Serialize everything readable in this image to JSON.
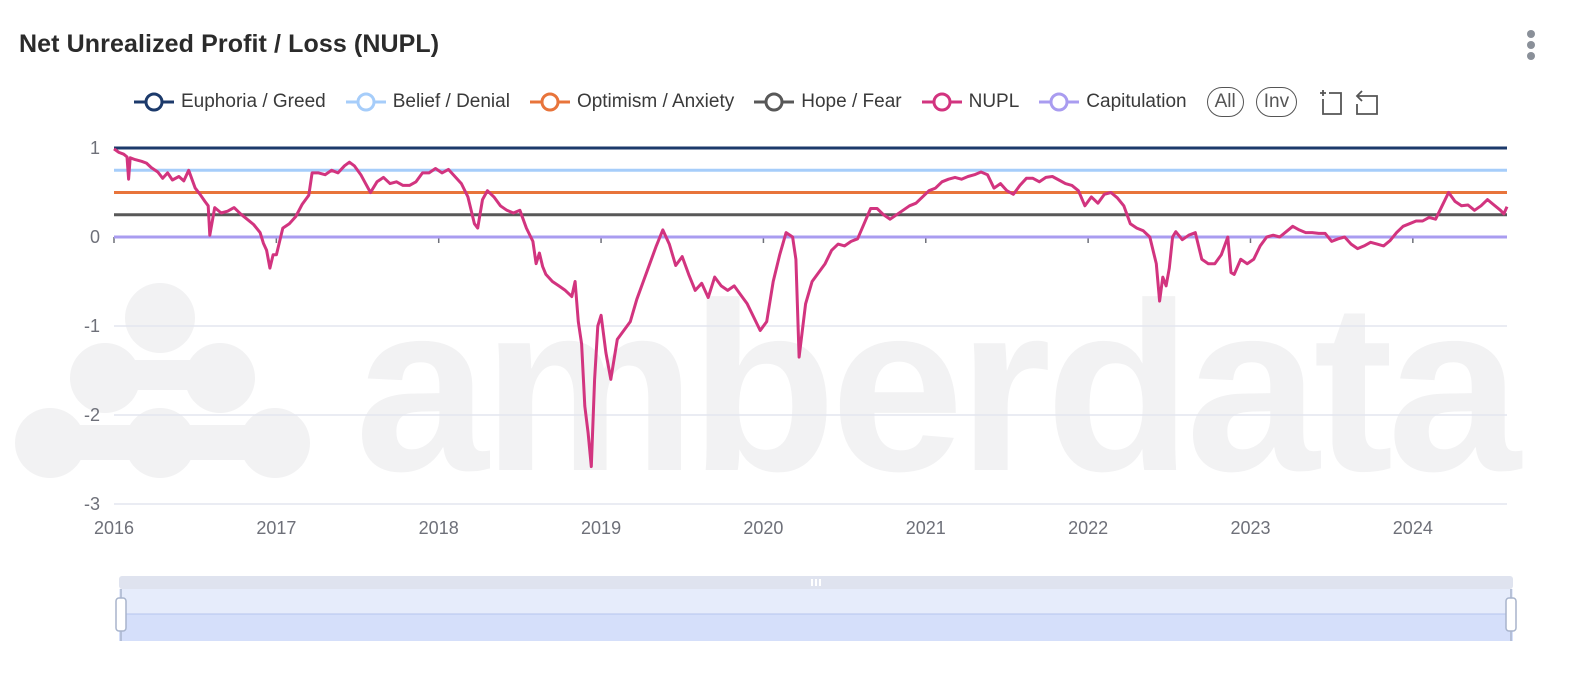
{
  "header": {
    "title": "Net Unrealized Profit / Loss (NUPL)",
    "menu_icon": "more-vertical-icon"
  },
  "legend": {
    "items": [
      {
        "label": "Euphoria / Greed",
        "color": "#1c3a6b"
      },
      {
        "label": "Belief / Denial",
        "color": "#a6cdfa"
      },
      {
        "label": "Optimism / Anxiety",
        "color": "#e8743b"
      },
      {
        "label": "Hope / Fear",
        "color": "#585858"
      },
      {
        "label": "NUPL",
        "color": "#d2347f"
      },
      {
        "label": "Capitulation",
        "color": "#a99cf0"
      }
    ],
    "all_label": "All",
    "inv_label": "Inv",
    "tools": [
      "zoom-select-icon",
      "zoom-reset-icon"
    ]
  },
  "watermark": "amberdata",
  "chart_data": {
    "type": "line",
    "title": "Net Unrealized Profit / Loss (NUPL)",
    "xlabel": "",
    "ylabel": "",
    "xlim": [
      2016.0,
      2024.58
    ],
    "ylim": [
      -3,
      1
    ],
    "x_ticks": [
      "2016",
      "2017",
      "2018",
      "2019",
      "2020",
      "2021",
      "2022",
      "2023",
      "2024"
    ],
    "y_ticks": [
      "1",
      "0",
      "-1",
      "-2",
      "-3"
    ],
    "grid": true,
    "legend_position": "top-right",
    "reference_lines": [
      {
        "name": "Euphoria / Greed",
        "value": 1.0,
        "color": "#1c3a6b"
      },
      {
        "name": "Belief / Denial",
        "value": 0.75,
        "color": "#a6cdfa"
      },
      {
        "name": "Optimism / Anxiety",
        "value": 0.5,
        "color": "#e8743b"
      },
      {
        "name": "Hope / Fear",
        "value": 0.25,
        "color": "#585858"
      },
      {
        "name": "Capitulation",
        "value": 0.0,
        "color": "#a99cf0"
      }
    ],
    "series": [
      {
        "name": "NUPL",
        "color": "#d2347f",
        "x": [
          2016.0,
          2016.03,
          2016.06,
          2016.08,
          2016.09,
          2016.1,
          2016.13,
          2016.17,
          2016.2,
          2016.23,
          2016.27,
          2016.3,
          2016.33,
          2016.36,
          2016.4,
          2016.43,
          2016.46,
          2016.5,
          2016.53,
          2016.56,
          2016.58,
          2016.59,
          2016.62,
          2016.66,
          2016.7,
          2016.74,
          2016.78,
          2016.82,
          2016.86,
          2016.9,
          2016.92,
          2016.94,
          2016.96,
          2016.98,
          2017.0,
          2017.04,
          2017.08,
          2017.12,
          2017.16,
          2017.2,
          2017.22,
          2017.26,
          2017.3,
          2017.34,
          2017.38,
          2017.42,
          2017.45,
          2017.48,
          2017.52,
          2017.55,
          2017.58,
          2017.62,
          2017.66,
          2017.7,
          2017.74,
          2017.78,
          2017.82,
          2017.86,
          2017.9,
          2017.94,
          2017.98,
          2018.02,
          2018.06,
          2018.1,
          2018.14,
          2018.18,
          2018.22,
          2018.24,
          2018.27,
          2018.3,
          2018.34,
          2018.38,
          2018.42,
          2018.46,
          2018.5,
          2018.54,
          2018.58,
          2018.6,
          2018.62,
          2018.64,
          2018.66,
          2018.7,
          2018.74,
          2018.78,
          2018.82,
          2018.84,
          2018.86,
          2018.88,
          2018.9,
          2018.92,
          2018.94,
          2018.96,
          2018.98,
          2019.0,
          2019.03,
          2019.06,
          2019.1,
          2019.14,
          2019.18,
          2019.22,
          2019.26,
          2019.3,
          2019.34,
          2019.38,
          2019.42,
          2019.46,
          2019.5,
          2019.54,
          2019.58,
          2019.62,
          2019.66,
          2019.7,
          2019.74,
          2019.78,
          2019.82,
          2019.86,
          2019.9,
          2019.94,
          2019.98,
          2020.02,
          2020.06,
          2020.1,
          2020.14,
          2020.18,
          2020.2,
          2020.22,
          2020.26,
          2020.3,
          2020.34,
          2020.38,
          2020.42,
          2020.46,
          2020.5,
          2020.54,
          2020.58,
          2020.62,
          2020.66,
          2020.7,
          2020.74,
          2020.78,
          2020.82,
          2020.86,
          2020.9,
          2020.94,
          2020.98,
          2021.02,
          2021.06,
          2021.1,
          2021.14,
          2021.18,
          2021.22,
          2021.26,
          2021.3,
          2021.34,
          2021.38,
          2021.42,
          2021.46,
          2021.5,
          2021.54,
          2021.58,
          2021.62,
          2021.66,
          2021.7,
          2021.74,
          2021.78,
          2021.82,
          2021.86,
          2021.9,
          2021.94,
          2021.98,
          2022.02,
          2022.06,
          2022.1,
          2022.14,
          2022.18,
          2022.22,
          2022.26,
          2022.3,
          2022.34,
          2022.38,
          2022.42,
          2022.44,
          2022.46,
          2022.48,
          2022.5,
          2022.52,
          2022.54,
          2022.58,
          2022.62,
          2022.66,
          2022.7,
          2022.74,
          2022.78,
          2022.82,
          2022.86,
          2022.88,
          2022.9,
          2022.94,
          2022.98,
          2023.02,
          2023.06,
          2023.1,
          2023.14,
          2023.18,
          2023.22,
          2023.26,
          2023.3,
          2023.34,
          2023.38,
          2023.42,
          2023.46,
          2023.5,
          2023.54,
          2023.58,
          2023.62,
          2023.66,
          2023.7,
          2023.74,
          2023.78,
          2023.82,
          2023.86,
          2023.9,
          2023.94,
          2023.98,
          2024.02,
          2024.06,
          2024.1,
          2024.14,
          2024.18,
          2024.22,
          2024.26,
          2024.3,
          2024.34,
          2024.38,
          2024.42,
          2024.46,
          2024.5,
          2024.54,
          2024.56,
          2024.58
        ],
        "y": [
          0.99,
          0.95,
          0.93,
          0.9,
          0.65,
          0.89,
          0.87,
          0.85,
          0.83,
          0.78,
          0.73,
          0.66,
          0.72,
          0.64,
          0.68,
          0.63,
          0.75,
          0.55,
          0.48,
          0.4,
          0.35,
          0.02,
          0.33,
          0.27,
          0.29,
          0.33,
          0.26,
          0.2,
          0.14,
          0.05,
          -0.07,
          -0.15,
          -0.35,
          -0.2,
          -0.2,
          0.1,
          0.15,
          0.23,
          0.37,
          0.47,
          0.72,
          0.72,
          0.7,
          0.75,
          0.72,
          0.8,
          0.84,
          0.8,
          0.7,
          0.6,
          0.5,
          0.62,
          0.67,
          0.6,
          0.62,
          0.58,
          0.58,
          0.62,
          0.72,
          0.72,
          0.77,
          0.72,
          0.76,
          0.68,
          0.6,
          0.45,
          0.15,
          0.1,
          0.42,
          0.52,
          0.45,
          0.35,
          0.3,
          0.27,
          0.3,
          0.1,
          -0.05,
          -0.3,
          -0.18,
          -0.33,
          -0.42,
          -0.5,
          -0.55,
          -0.6,
          -0.67,
          -0.5,
          -0.95,
          -1.2,
          -1.9,
          -2.2,
          -2.58,
          -1.6,
          -1.0,
          -0.88,
          -1.3,
          -1.6,
          -1.15,
          -1.05,
          -0.95,
          -0.7,
          -0.5,
          -0.3,
          -0.1,
          0.08,
          -0.08,
          -0.32,
          -0.22,
          -0.42,
          -0.6,
          -0.52,
          -0.68,
          -0.45,
          -0.55,
          -0.6,
          -0.55,
          -0.65,
          -0.75,
          -0.9,
          -1.05,
          -0.95,
          -0.5,
          -0.2,
          0.05,
          0.0,
          -0.25,
          -1.35,
          -0.75,
          -0.5,
          -0.4,
          -0.3,
          -0.15,
          -0.08,
          -0.1,
          -0.05,
          -0.02,
          0.15,
          0.32,
          0.32,
          0.25,
          0.2,
          0.25,
          0.3,
          0.35,
          0.38,
          0.45,
          0.52,
          0.55,
          0.62,
          0.65,
          0.67,
          0.65,
          0.68,
          0.7,
          0.73,
          0.7,
          0.55,
          0.6,
          0.52,
          0.48,
          0.58,
          0.66,
          0.66,
          0.62,
          0.67,
          0.68,
          0.64,
          0.6,
          0.58,
          0.52,
          0.35,
          0.45,
          0.38,
          0.48,
          0.5,
          0.44,
          0.35,
          0.15,
          0.1,
          0.07,
          0.0,
          -0.3,
          -0.72,
          -0.45,
          -0.55,
          -0.35,
          0.0,
          0.06,
          -0.03,
          0.02,
          0.05,
          -0.25,
          -0.3,
          -0.3,
          -0.2,
          0.0,
          -0.4,
          -0.42,
          -0.25,
          -0.3,
          -0.25,
          -0.1,
          0.0,
          0.02,
          0.0,
          0.06,
          0.12,
          0.08,
          0.05,
          0.05,
          0.04,
          0.04,
          -0.05,
          -0.02,
          0.0,
          -0.08,
          -0.13,
          -0.1,
          -0.06,
          -0.08,
          -0.1,
          -0.04,
          0.05,
          0.12,
          0.15,
          0.18,
          0.18,
          0.22,
          0.2,
          0.35,
          0.5,
          0.4,
          0.35,
          0.36,
          0.3,
          0.35,
          0.42,
          0.36,
          0.3,
          0.26,
          0.34,
          0.28
        ]
      }
    ]
  },
  "slider": {
    "range_start_pct": 0,
    "range_end_pct": 100,
    "handle_label": "drag-handle"
  }
}
